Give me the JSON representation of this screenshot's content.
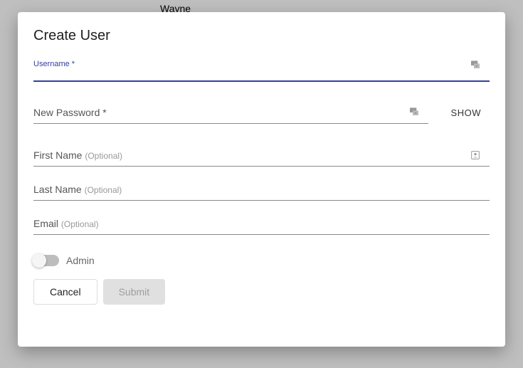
{
  "background": {
    "peek_text": "Wayne"
  },
  "modal": {
    "title": "Create User",
    "fields": {
      "username": {
        "label": "Username *",
        "value": ""
      },
      "password": {
        "label": "New Password *",
        "value": "",
        "show_button": "SHOW"
      },
      "first_name": {
        "label": "First Name",
        "optional": "(Optional)",
        "value": ""
      },
      "last_name": {
        "label": "Last Name",
        "optional": "(Optional)",
        "value": ""
      },
      "email": {
        "label": "Email",
        "optional": "(Optional)",
        "value": ""
      }
    },
    "toggle": {
      "label": "Admin",
      "checked": false
    },
    "buttons": {
      "cancel": "Cancel",
      "submit": "Submit"
    }
  },
  "colors": {
    "accent": "#303f9f"
  }
}
